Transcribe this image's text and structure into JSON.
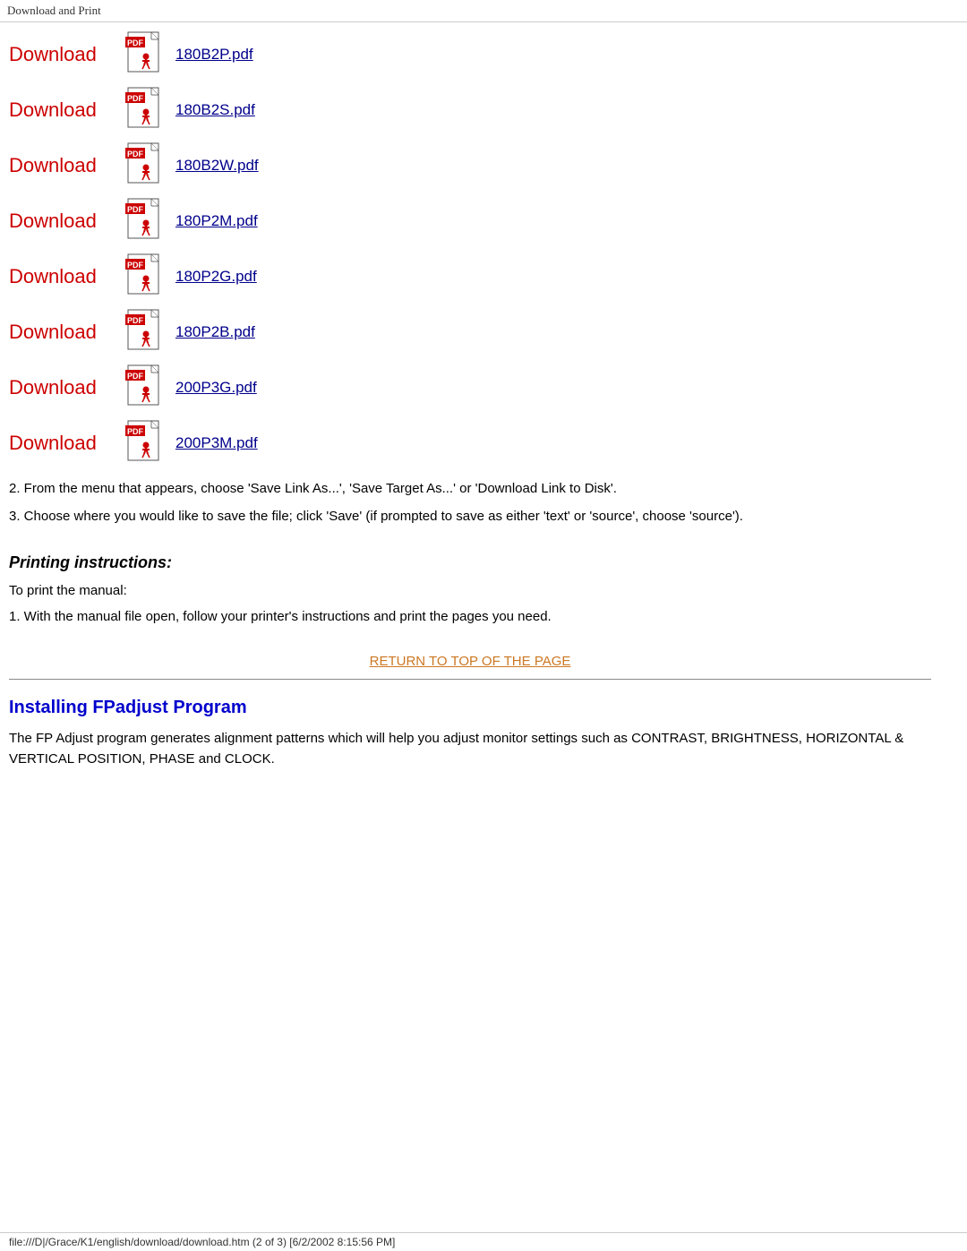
{
  "topbar": {
    "label": "Download and Print"
  },
  "downloads": [
    {
      "label": "Download",
      "filename": "180B2P.pdf",
      "href": "180B2P.pdf"
    },
    {
      "label": "Download",
      "filename": "180B2S.pdf",
      "href": "180B2S.pdf"
    },
    {
      "label": "Download",
      "filename": "180B2W.pdf",
      "href": "180B2W.pdf"
    },
    {
      "label": "Download",
      "filename": "180P2M.pdf",
      "href": "180P2M.pdf"
    },
    {
      "label": "Download",
      "filename": "180P2G.pdf",
      "href": "180P2G.pdf"
    },
    {
      "label": "Download",
      "filename": "180P2B.pdf",
      "href": "180P2B.pdf"
    },
    {
      "label": "Download",
      "filename": "200P3G.pdf",
      "href": "200P3G.pdf"
    },
    {
      "label": "Download",
      "filename": "200P3M.pdf",
      "href": "200P3M.pdf"
    }
  ],
  "step2_text": "2. From the menu that appears, choose 'Save Link As...', 'Save Target As...' or 'Download Link to Disk'.",
  "step3_text": "3. Choose where you would like to save the file; click 'Save' (if prompted to save as either 'text' or 'source', choose 'source').",
  "printing_title": "Printing instructions:",
  "printing_intro": "To print the manual:",
  "printing_step1": "1. With the manual file open, follow your printer's instructions and print the pages you need.",
  "return_link_text": "RETURN TO TOP OF THE PAGE",
  "installing_title": "Installing FPadjust Program",
  "fp_description": "The FP Adjust program generates alignment patterns which will help you adjust monitor settings such as CONTRAST, BRIGHTNESS, HORIZONTAL & VERTICAL POSITION, PHASE and CLOCK.",
  "footer_text": "file:///D|/Grace/K1/english/download/download.htm (2 of 3) [6/2/2002 8:15:56 PM]"
}
